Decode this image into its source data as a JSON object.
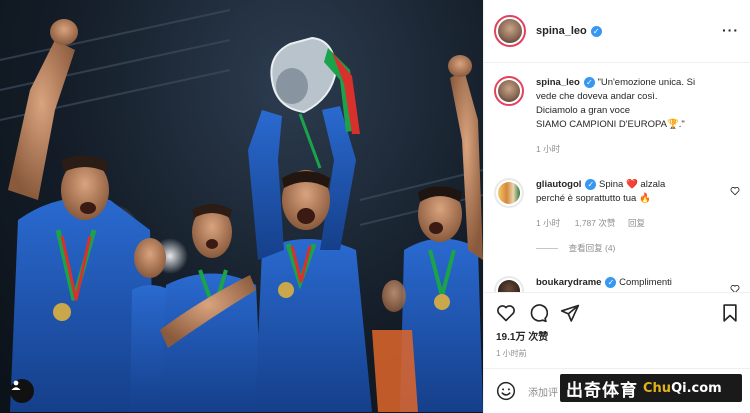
{
  "post": {
    "username": "spina_leo",
    "more_icon": "more-horizontal-icon"
  },
  "caption": {
    "username": "spina_leo",
    "text_line1": "\"Un'emozione unica. Si",
    "text_line2": "vede che doveva andar così.",
    "text_line3": "Diciamolo a gran voce",
    "text_line4": "SIAMO CAMPIONI D'EUROPA🏆.\"",
    "time": "1 小时"
  },
  "comments": [
    {
      "username": "gliautogol",
      "text_line1": "Spina ❤️ alzala",
      "text_line2": "perché è soprattutto tua 🔥",
      "time": "1 小时",
      "likes": "1,787 次赞",
      "reply": "回复",
      "view_replies": "查看回复 (4)"
    },
    {
      "username": "boukarydrame",
      "text": "Complimenti"
    }
  ],
  "actions": {
    "like_icon": "heart-icon",
    "comment_icon": "comment-icon",
    "share_icon": "send-icon",
    "save_icon": "bookmark-icon"
  },
  "likes": "19.1万 次赞",
  "time_ago": "1 小时前",
  "add_comment_placeholder": "添加评",
  "watermark": {
    "cn": "出奇体育",
    "en_prefix": "Chu",
    "en_suffix": "Qi.com"
  },
  "colors": {
    "italy_blue": "#1f58b8",
    "verified": "#3897f0",
    "heart": "#ed4956"
  }
}
